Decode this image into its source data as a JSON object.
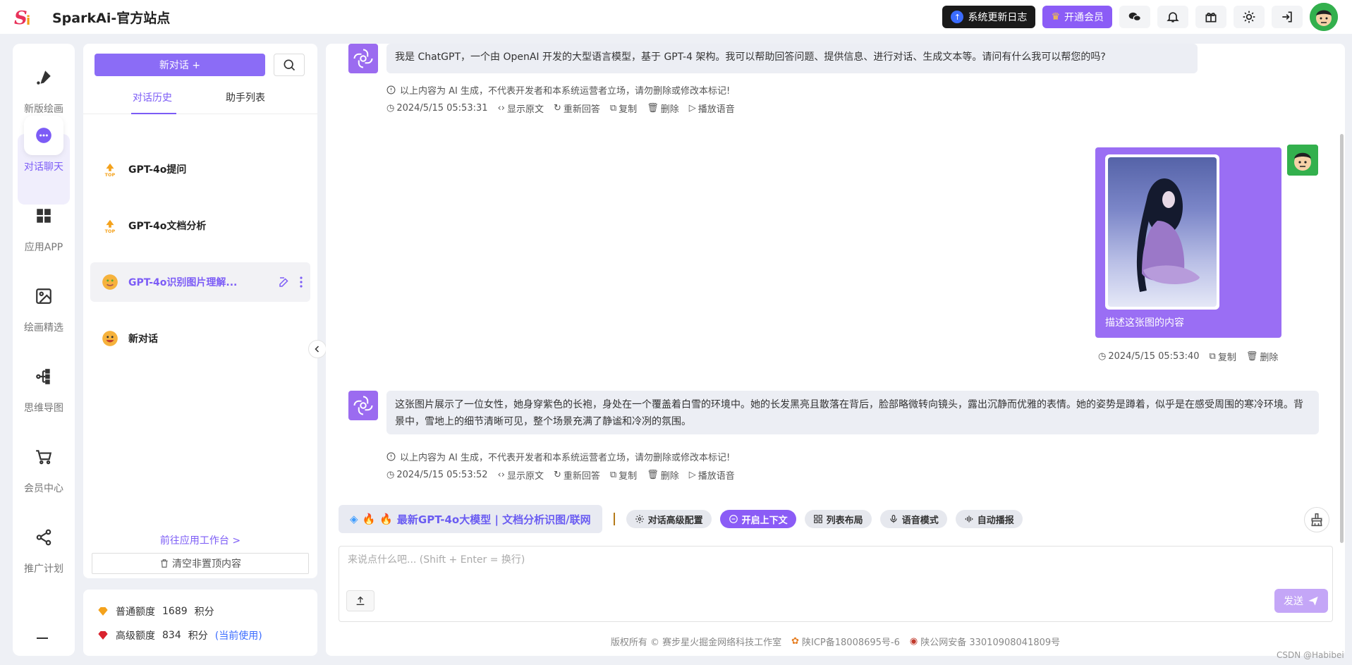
{
  "header": {
    "app_title": "SparkAi-官方站点",
    "update_log": "系统更新日志",
    "vip": "开通会员"
  },
  "rail": {
    "items": [
      {
        "label": "新版绘画"
      },
      {
        "label": "对话聊天"
      },
      {
        "label": "应用APP"
      },
      {
        "label": "绘画精选"
      },
      {
        "label": "思维导图"
      },
      {
        "label": "会员中心"
      },
      {
        "label": "推广计划"
      }
    ]
  },
  "sidebar": {
    "new_chat": "新对话 +",
    "tabs": [
      "对话历史",
      "助手列表"
    ],
    "conversations": [
      {
        "title": "GPT-4o提问"
      },
      {
        "title": "GPT-4o文档分析"
      },
      {
        "title": "GPT-4o识别图片理解..."
      },
      {
        "title": "新对话"
      }
    ],
    "goto_workspace": "前往应用工作台 >",
    "clear_unpinned": "清空非置顶内容"
  },
  "credits": {
    "normal_label": "普通额度",
    "normal_value": "1689",
    "advanced_label": "高级额度",
    "advanced_value": "834",
    "unit": "积分",
    "current_use": "(当前使用)"
  },
  "messages": {
    "m1": {
      "text": "我是 ChatGPT，一个由 OpenAI 开发的大型语言模型，基于 GPT-4 架构。我可以帮助回答问题、提供信息、进行对话、生成文本等。请问有什么我可以帮您的吗?",
      "disclaimer": "以上内容为 AI 生成，不代表开发者和本系统运营者立场，请勿删除或修改本标记!",
      "time": "2024/5/15 05:53:31"
    },
    "m2": {
      "text": "描述这张图的内容",
      "time": "2024/5/15 05:53:40"
    },
    "m3": {
      "text": "这张图片展示了一位女性，她身穿紫色的长袍，身处在一个覆盖着白雪的环境中。她的长发黑亮且散落在背后，脸部略微转向镜头，露出沉静而优雅的表情。她的姿势是蹲着，似乎是在感受周围的寒冷环境。背景中，雪地上的细节清晰可见，整个场景充满了静谧和冷冽的氛围。",
      "disclaimer": "以上内容为 AI 生成，不代表开发者和本系统运营者立场，请勿删除或修改本标记!",
      "time": "2024/5/15 05:53:52"
    },
    "actions": {
      "show_raw": "显示原文",
      "regen": "重新回答",
      "copy": "复制",
      "delete": "删除",
      "play": "播放语音"
    }
  },
  "toolbar": {
    "model": "最新GPT-4o大模型 | 文档分析识图/联网",
    "advanced": "对话高级配置",
    "context": "开启上下文",
    "layout": "列表布局",
    "voice": "语音模式",
    "autoplay": "自动播报"
  },
  "input": {
    "placeholder": "来说点什么吧... (Shift + Enter = 换行)",
    "send": "发送"
  },
  "footer": {
    "copyright": "版权所有 © 赛步星火掘金网络科技工作室",
    "icp": "陕ICP备18008695号-6",
    "police": "陕公网安备 33010908041809号"
  },
  "watermark": "CSDN @Habibei",
  "colors": {
    "accent": "#8b5cf6",
    "bot_avatar": "#9b6bf0"
  }
}
